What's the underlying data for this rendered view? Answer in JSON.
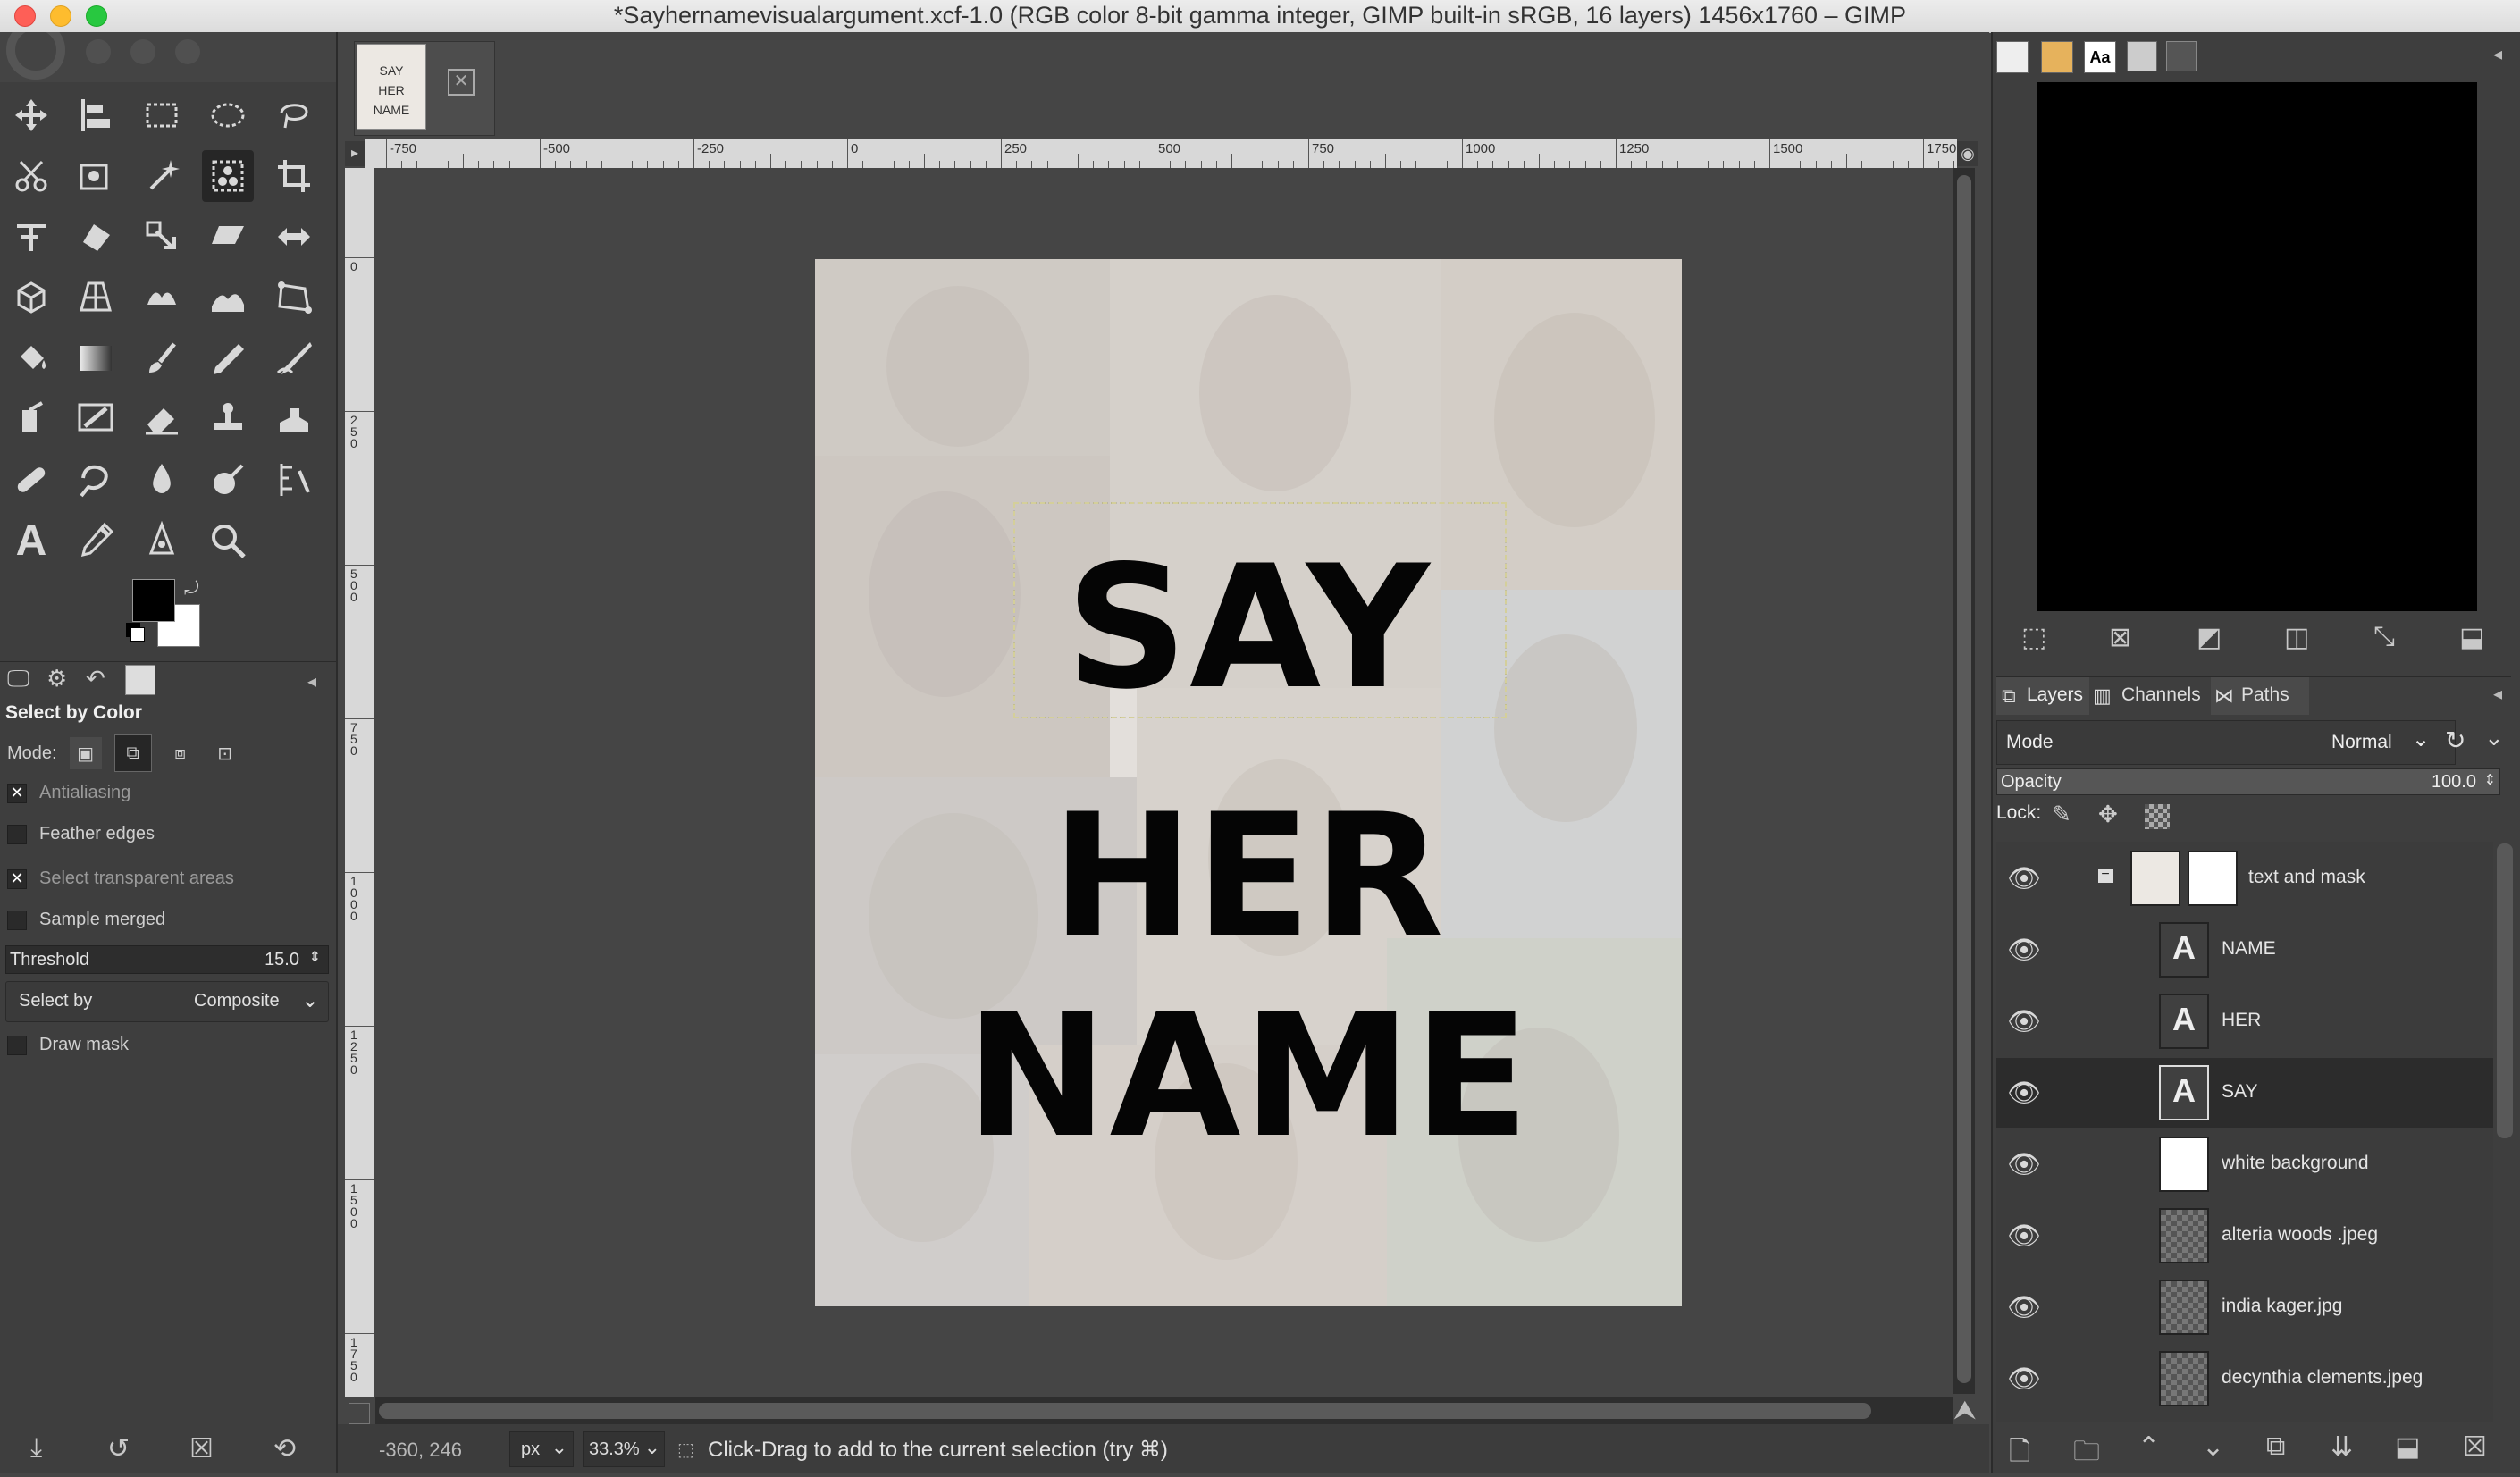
{
  "window": {
    "title": "*Sayhernamevisualargument.xcf-1.0 (RGB color 8-bit gamma integer, GIMP built-in sRGB, 16 layers) 1456x1760 – GIMP"
  },
  "toolbox": {
    "tools": [
      "move-tool",
      "align-tool",
      "rect-select-tool",
      "ellipse-select-tool",
      "free-select-tool",
      "scissors-select-tool",
      "foreground-select-tool",
      "fuzzy-select-tool",
      "select-by-color-tool",
      "crop-tool",
      "unified-transform-tool",
      "warp-transform-tool",
      "scale-tool",
      "shear-tool",
      "flip-tool",
      "3d-transform-tool",
      "perspective-tool",
      "cage-transform-tool",
      "perspective-clone-tool",
      "handle-transform-tool",
      "bucket-fill-tool",
      "gradient-tool",
      "paintbrush-tool",
      "pencil-tool",
      "ink-tool",
      "airbrush-tool",
      "mypaint-brush-tool",
      "eraser-tool",
      "clone-tool",
      "heal-tool",
      "smudge-tool",
      "dodge-tool",
      "blur-tool",
      "convolve-tool",
      "measure-tool",
      "text-tool",
      "color-picker-tool",
      "paths-tool",
      "zoom-tool"
    ],
    "fg_color": "#000000",
    "bg_color": "#ffffff"
  },
  "tool_options": {
    "title": "Select by Color",
    "mode_label": "Mode:",
    "antialiasing": "Antialiasing",
    "feather_edges": "Feather edges",
    "select_transparent": "Select transparent areas",
    "sample_merged": "Sample merged",
    "threshold_label": "Threshold",
    "threshold_value": "15.0",
    "select_by_label": "Select by",
    "select_by_value": "Composite",
    "draw_mask": "Draw mask"
  },
  "image_tab": {
    "thumb_text_1": "SAY",
    "thumb_text_2": "HER",
    "thumb_text_3": "NAME"
  },
  "ruler": {
    "top_labels": [
      "-750",
      "-500",
      "-250",
      "0",
      "250",
      "500",
      "750",
      "1000",
      "1250",
      "1500",
      "1750"
    ],
    "left_labels": [
      "0",
      "250",
      "500",
      "750",
      "1000",
      "1250",
      "1500",
      "1750"
    ]
  },
  "canvas": {
    "word_1": "SAY",
    "word_2": "HER",
    "word_3": "NAME"
  },
  "status": {
    "coords": "-360, 246",
    "unit": "px",
    "zoom": "33.3%",
    "message": "Click-Drag to add to the current selection (try ⌘)"
  },
  "dock": {
    "tabs": [
      "Layers",
      "Channels",
      "Paths"
    ],
    "mode_label": "Mode",
    "mode_value": "Normal",
    "opacity_label": "Opacity",
    "opacity_value": "100.0",
    "lock_label": "Lock:"
  },
  "layers": [
    {
      "name": "text and mask",
      "kind": "group"
    },
    {
      "name": "NAME",
      "kind": "text"
    },
    {
      "name": "HER",
      "kind": "text"
    },
    {
      "name": "SAY",
      "kind": "text",
      "selected": true
    },
    {
      "name": "white background",
      "kind": "white"
    },
    {
      "name": "alteria woods .jpeg",
      "kind": "image"
    },
    {
      "name": "india kager.jpg",
      "kind": "image"
    },
    {
      "name": "decynthia clements.jpeg",
      "kind": "image"
    }
  ]
}
